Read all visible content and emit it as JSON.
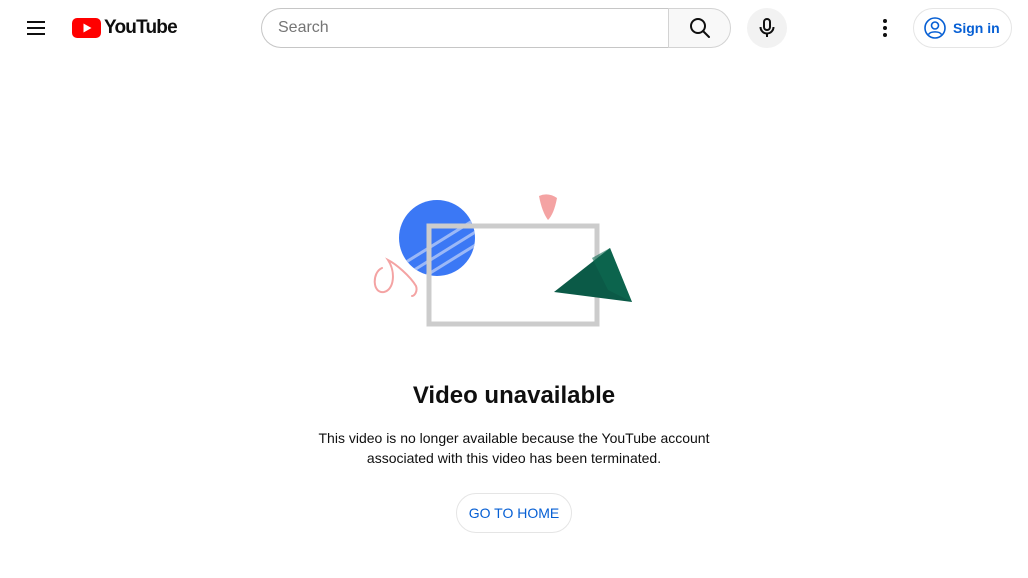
{
  "header": {
    "logo_text": "YouTube",
    "search": {
      "placeholder": "Search",
      "value": ""
    },
    "signin_label": "Sign in",
    "icons": {
      "menu": "hamburger-menu-icon",
      "search": "search-icon",
      "mic": "microphone-icon",
      "more": "vertical-dots-icon",
      "account": "account-circle-icon"
    }
  },
  "error": {
    "title": "Video unavailable",
    "message": "This video is no longer available because the YouTube account associated with this video has been terminated.",
    "home_button": "GO TO HOME"
  },
  "colors": {
    "brand_red": "#ff0000",
    "link_blue": "#065fd4",
    "text": "#0f0f0f",
    "illustration_blue": "#3b78f5",
    "illustration_green": "#0b5a47",
    "illustration_pink": "#f4a3a3",
    "illustration_frame": "#cccccc"
  }
}
